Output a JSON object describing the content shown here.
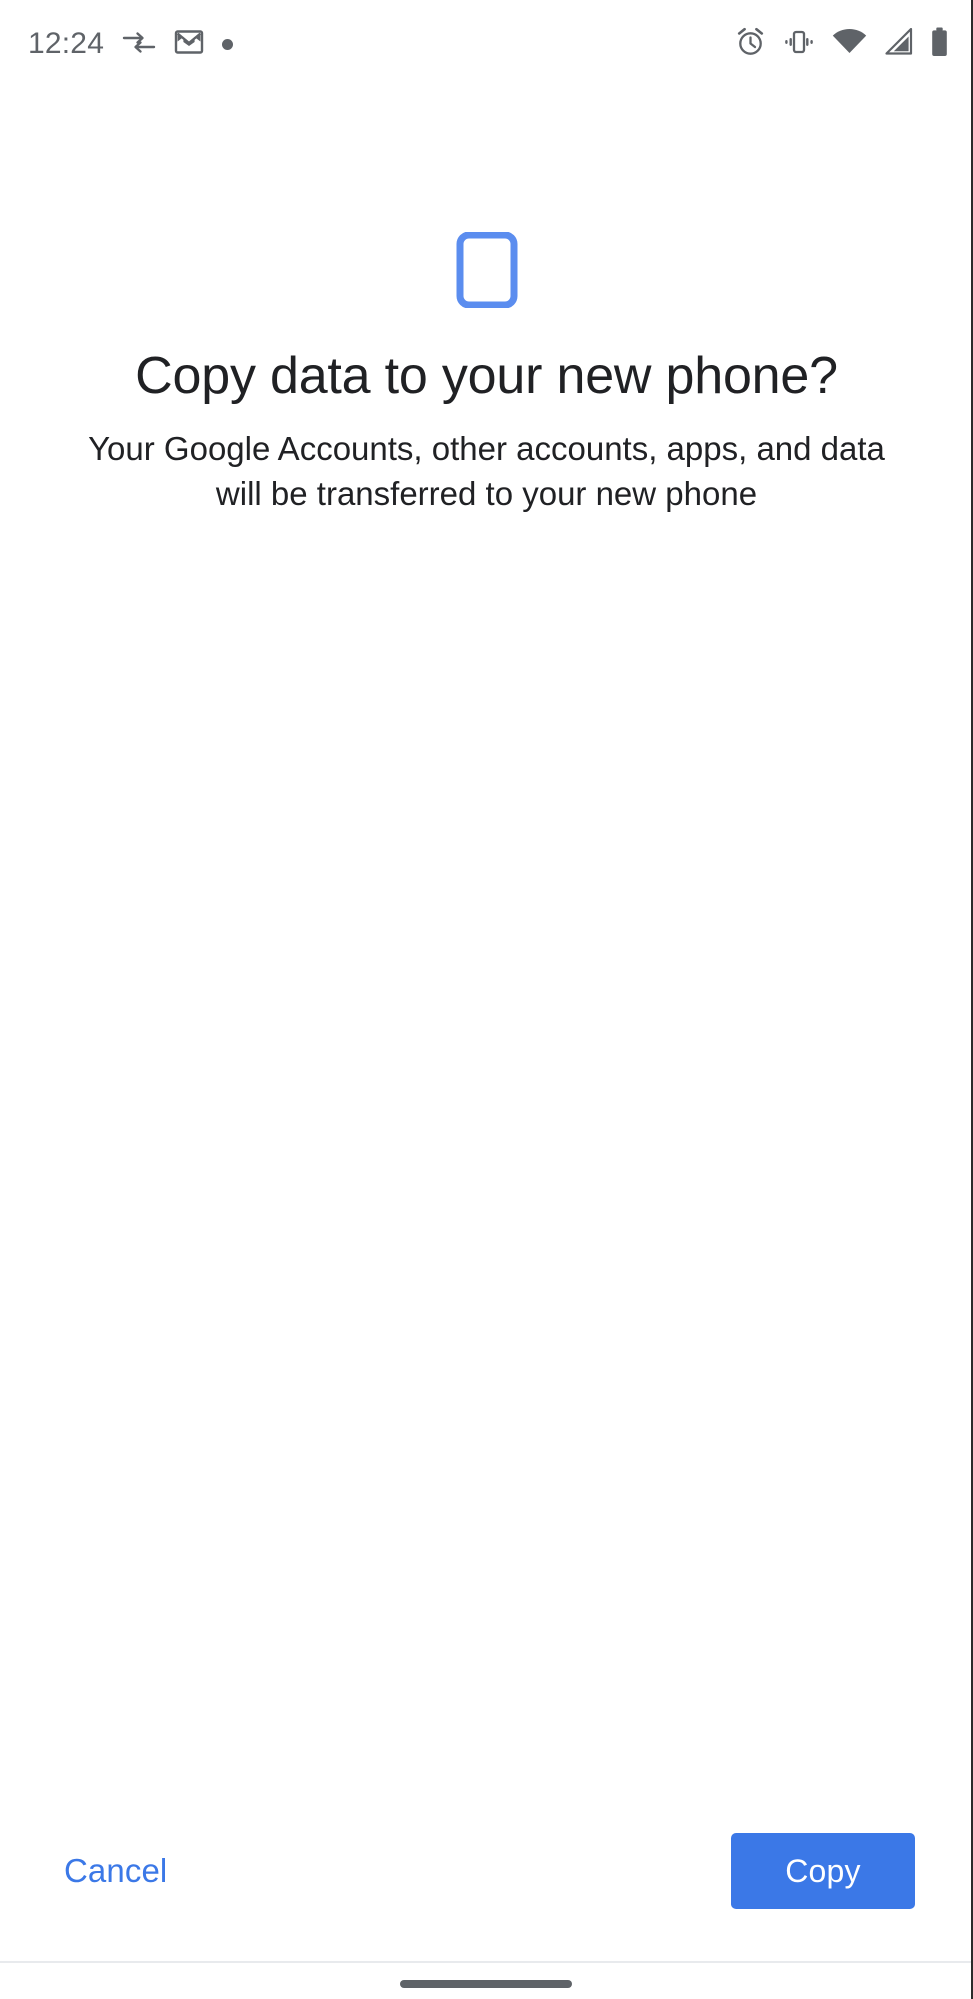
{
  "status_bar": {
    "time": "12:24",
    "left_icons": [
      {
        "name": "data-transfer-icon",
        "label": "Data transfer"
      },
      {
        "name": "gmail-icon",
        "label": "Gmail"
      },
      {
        "name": "notification-dot-icon",
        "label": "Notification"
      }
    ],
    "right_icons": [
      {
        "name": "alarm-clock-icon",
        "label": "Alarm set"
      },
      {
        "name": "vibrate-icon",
        "label": "Vibrate mode"
      },
      {
        "name": "wifi-icon",
        "label": "Wi-Fi full signal"
      },
      {
        "name": "cellular-signal-icon",
        "label": "Cellular signal"
      },
      {
        "name": "battery-icon",
        "label": "Battery full"
      }
    ]
  },
  "hero": {
    "illustration_icon": "smartphone-icon",
    "title": "Copy data to your new phone?",
    "subtitle": "Your Google Accounts, other accounts, apps, and data will be transferred to your new phone"
  },
  "actions": {
    "cancel_label": "Cancel",
    "copy_label": "Copy"
  },
  "nav_bar": {
    "home_indicator": "home-indicator"
  },
  "colors": {
    "accent_blue": "#3b78e7",
    "illustration_blue": "#5b8def",
    "text_primary": "#202124",
    "status_icon_gray": "#5f6368",
    "divider": "#e8eaed",
    "background": "#ffffff"
  }
}
